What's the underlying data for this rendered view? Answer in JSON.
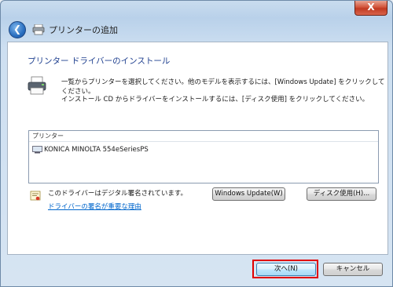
{
  "window": {
    "close_label": "X"
  },
  "header": {
    "title": "プリンターの追加"
  },
  "main": {
    "section_title": "プリンター ドライバーのインストール",
    "description_line1": "一覧からプリンターを選択してください。他のモデルを表示するには、[Windows Update] をクリックしてください。",
    "description_line2": "インストール CD からドライバーをインストールするには、[ディスク使用] をクリックしてください。",
    "printer_list": {
      "header": "プリンター",
      "items": [
        "KONICA MINOLTA 554eSeriesPS"
      ]
    },
    "signature_text": "このドライバーはデジタル署名されています。",
    "signature_link": "ドライバーの署名が重要な理由",
    "windows_update_button": "Windows Update(W)",
    "have_disk_button": "ディスク使用(H)..."
  },
  "footer": {
    "next_button": "次へ(N)",
    "cancel_button": "キャンセル"
  },
  "colors": {
    "highlight": "#e00000",
    "link": "#0066cc",
    "section_title": "#1e3f8f"
  }
}
